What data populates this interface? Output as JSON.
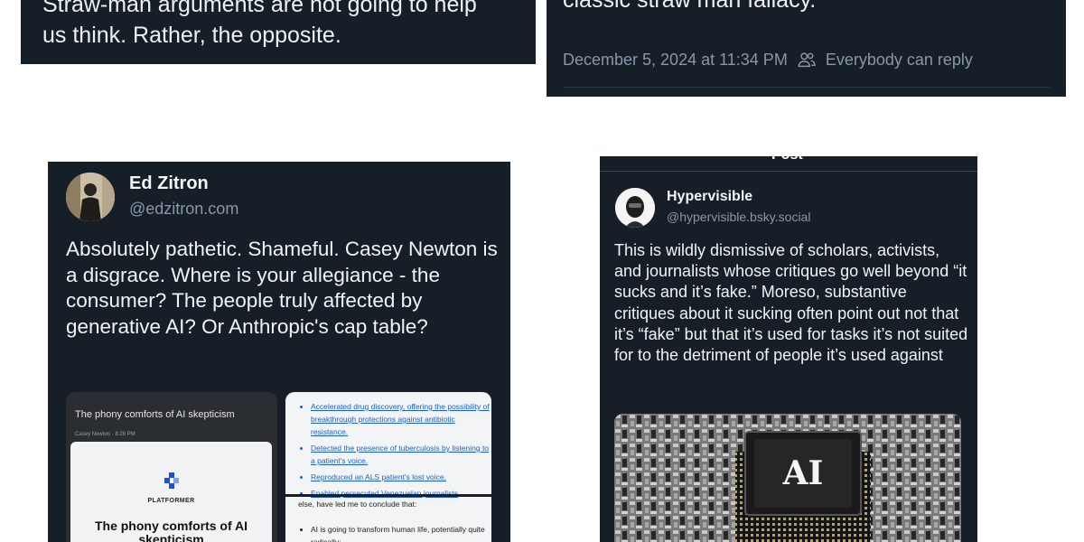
{
  "card1": {
    "lines": [
      "Straw-man arguments are not going to help",
      "us think. Rather, the opposite."
    ]
  },
  "card2": {
    "lines": [
      "classic straw man fallacy."
    ],
    "timestamp": "December 5, 2024 at 11:34 PM",
    "reply_setting": "Everybody can reply",
    "reply_icon": "people-icon"
  },
  "card3": {
    "author": {
      "name": "Ed Zitron",
      "handle": "@edzitron.com"
    },
    "text": "Absolutely pathetic. Shameful. Casey Newton is a disgrace. Where is your allegiance - the consumer? The people truly affected by generative AI? Or Anthropic's cap table?",
    "embed_left": {
      "title": "The phony comforts of AI skepticism",
      "byline": "Casey Newton · 8:28 PM",
      "publisher": "PLATFORMER",
      "headline": "The phony comforts of AI skepticism"
    },
    "embed_right": {
      "links": [
        "Accelerated drug discovery, offering the possibility of breakthrough protections against antibiotic resistance.",
        "Detected the presence of tuberculosis by listening to a patient's voice.",
        "Reproduced an ALS patient's lost voice.",
        "Enabled persecuted Venezuelan journalists"
      ],
      "continued": "else, have led me to conclude that:",
      "bullets": [
        "AI is going to transform human life, potentially quite radically;"
      ]
    }
  },
  "card4": {
    "header": "Post",
    "author": {
      "name": "Hypervisible",
      "handle": "@hypervisible.bsky.social"
    },
    "text": "This is wildly dismissive of scholars, activists, and journalists whose critiques go well beyond “it sucks and it’s fake.” Moreso, substantive critiques about it sucking often point out not that it’s “fake” but that it’s used for tasks it’s not suited for to the detriment of people it’s used against",
    "image_label": "AI"
  },
  "colors": {
    "card_bg": "#161e27",
    "muted_text": "#8a97a8",
    "link": "#1a5fd1"
  }
}
